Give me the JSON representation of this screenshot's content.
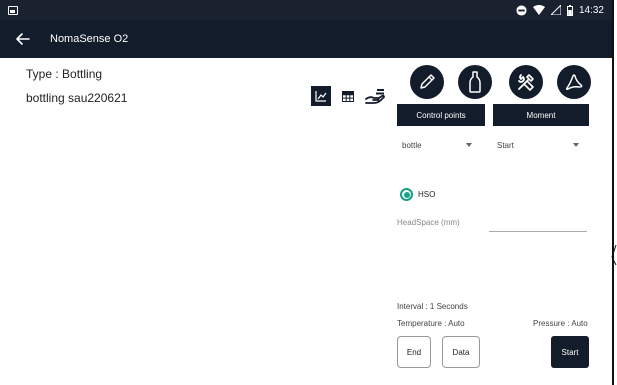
{
  "status_bar": {
    "time": "14:32"
  },
  "app_bar": {
    "title": "NomaSense O2"
  },
  "info": {
    "type_line": "Type : Bottling",
    "name_line": "bottling sau220621"
  },
  "buttons": {
    "control_points": "Control points",
    "moment": "Moment",
    "end": "End",
    "data": "Data",
    "start": "Start"
  },
  "dropdowns": {
    "bottle": "bottle",
    "moment_value": "Start"
  },
  "radio": {
    "label": "HSO",
    "selected": true
  },
  "headspace": {
    "label": "HeadSpace (mm)",
    "value": ""
  },
  "settings": {
    "interval": "Interval : 1 Seconds",
    "temperature": "Temperature : Auto",
    "pressure": "Pressure : Auto"
  },
  "icons": {
    "back": "arrow-left-icon",
    "chart": "chart-icon",
    "table": "table-icon",
    "hand": "hand-icon",
    "pencil": "pencil-icon",
    "bottle": "bottle-icon",
    "tools": "tools-icon",
    "pdf": "pdf-icon"
  },
  "colors": {
    "primary_dark": "#131c2a",
    "accent_teal": "#16a085"
  }
}
